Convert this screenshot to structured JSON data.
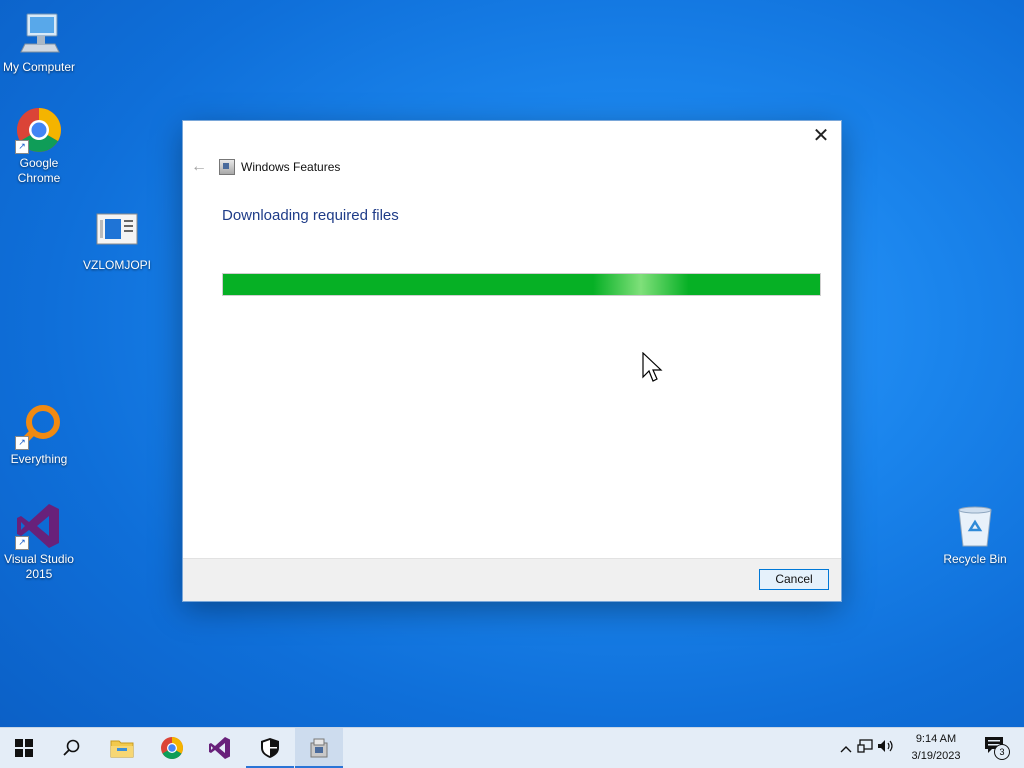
{
  "desktop": {
    "icons": [
      {
        "label": "My Computer",
        "icon": "computer-icon"
      },
      {
        "label": "Google Chrome",
        "icon": "chrome-icon"
      },
      {
        "label": "VZLOMJOPI",
        "icon": "document-icon"
      },
      {
        "label": "Everything",
        "icon": "everything-icon"
      },
      {
        "label": "Visual Studio 2015",
        "icon": "visual-studio-icon"
      },
      {
        "label": "Recycle Bin",
        "icon": "recycle-bin-icon"
      }
    ]
  },
  "dialog": {
    "window_title": "Windows Features",
    "heading": "Downloading required files",
    "progress_percent": 100,
    "cancel_label": "Cancel",
    "close_glyph": "✕",
    "back_glyph": "←"
  },
  "taskbar": {
    "apps": [
      "start-icon",
      "search-icon",
      "file-explorer-icon",
      "chrome-icon",
      "visual-studio-icon",
      "security-icon",
      "windows-features-icon"
    ],
    "time": "9:14 AM",
    "date": "3/19/2023",
    "notification_count": "3",
    "tray_chevron": "^"
  },
  "colors": {
    "accent": "#0078d7",
    "progress_green": "#06b025",
    "heading_blue": "#1f3c88"
  }
}
